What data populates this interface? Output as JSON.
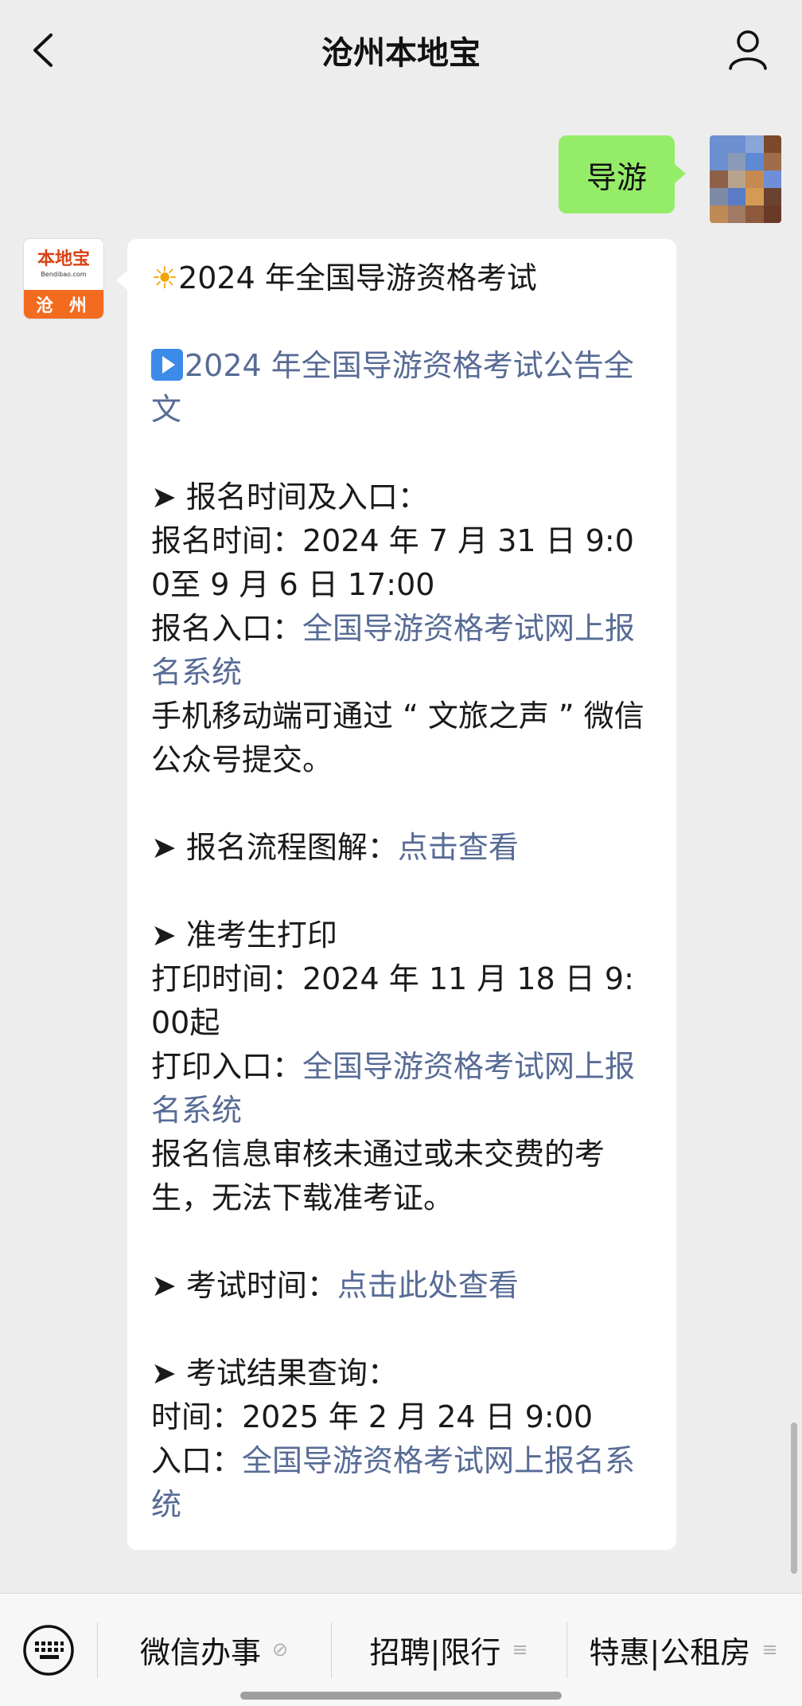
{
  "header": {
    "title": "沧州本地宝"
  },
  "outgoing": {
    "text": "导游"
  },
  "bot": {
    "brand": "本地宝",
    "domain": "Bendibao.com",
    "city": "沧 州"
  },
  "message": {
    "title": "2024 年全国导游资格考试",
    "announcement_link": "2024 年全国导游资格考试公告全文",
    "reg_heading": "➤ 报名时间及入口：",
    "reg_time": "报名时间：2024 年 7 月 31 日 9:00至 9 月 6 日 17:00",
    "reg_entry_label": "报名入口：",
    "reg_entry_link": "全国导游资格考试网上报名系统",
    "reg_mobile": "手机移动端可通过 “ 文旅之声 ” 微信公众号提交。",
    "flow_label": "➤ 报名流程图解：",
    "flow_link": "点击查看",
    "admit_heading": "➤ 准考生打印",
    "admit_time": "打印时间：2024 年 11 月 18 日 9:00起",
    "admit_entry_label": "打印入口：",
    "admit_entry_link": "全国导游资格考试网上报名系统",
    "admit_note": "报名信息审核未通过或未交费的考生，无法下载准考证。",
    "exam_label": "➤ 考试时间：",
    "exam_link": "点击此处查看",
    "result_heading": "➤ 考试结果查询：",
    "result_time": "时间：2025 年 2 月 24 日 9:00",
    "result_entry_label": "入口：",
    "result_entry_link": "全国导游资格考试网上报名系统"
  },
  "menu": [
    {
      "label": "微信办事",
      "suffix": "⊘"
    },
    {
      "label": "招聘|限行",
      "suffix": "≡"
    },
    {
      "label": "特惠|公租房",
      "suffix": "≡"
    }
  ]
}
